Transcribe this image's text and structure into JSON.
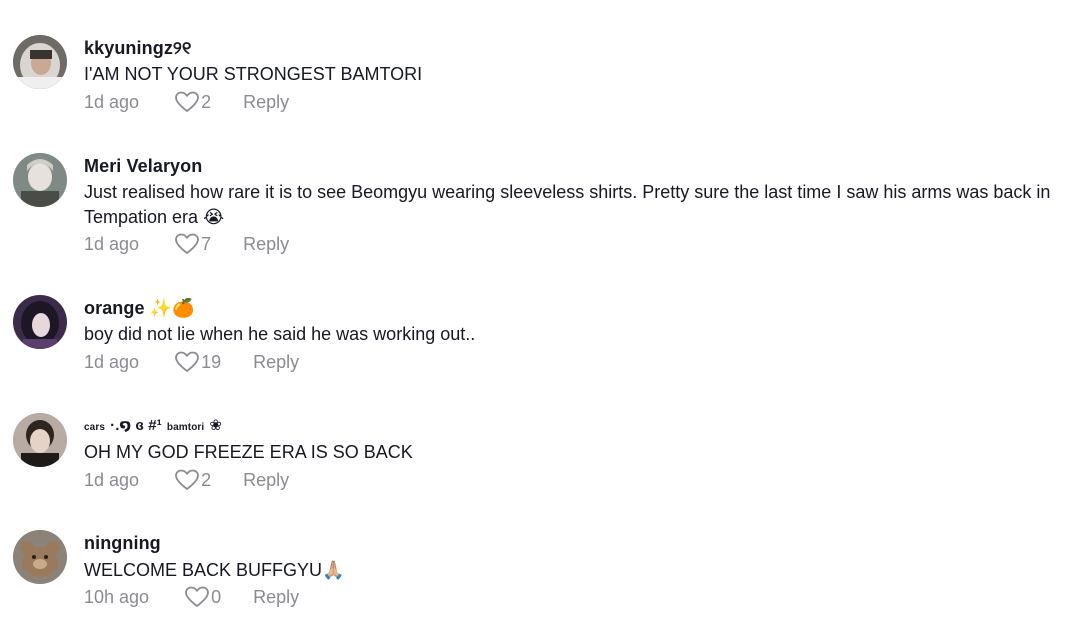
{
  "comments": [
    {
      "username": "kkyuningz୨୧",
      "text": "I'AM NOT YOUR STRONGEST BAMTORI",
      "time": "1d ago",
      "likes": "2",
      "reply_label": "Reply"
    },
    {
      "username": "Meri Velaryon",
      "text": "Just realised how rare it is to see Beomgyu wearing sleeveless shirts. Pretty sure the last time I saw his arms was back in Tempation era 😭",
      "time": "1d ago",
      "likes": "7",
      "reply_label": "Reply"
    },
    {
      "username": "orange ✨🍊",
      "text": "boy did not lie when he said he was working out..",
      "time": "1d ago",
      "likes": "19",
      "reply_label": "Reply"
    },
    {
      "username_parts": [
        "cars",
        "·.໑ ɞ #¹",
        "bamtori",
        "❀"
      ],
      "text": "OH MY GOD FREEZE ERA IS SO BACK",
      "time": "1d ago",
      "likes": "2",
      "reply_label": "Reply"
    },
    {
      "username": "ningning",
      "text": "WELCOME BACK BUFFGYU🙏🏼",
      "time": "10h ago",
      "likes": "0",
      "reply_label": "Reply"
    }
  ],
  "colors": {
    "text": "#161823",
    "muted": "#8a8b91",
    "background": "#ffffff"
  },
  "icons": {
    "like": "heart-outline-icon"
  }
}
